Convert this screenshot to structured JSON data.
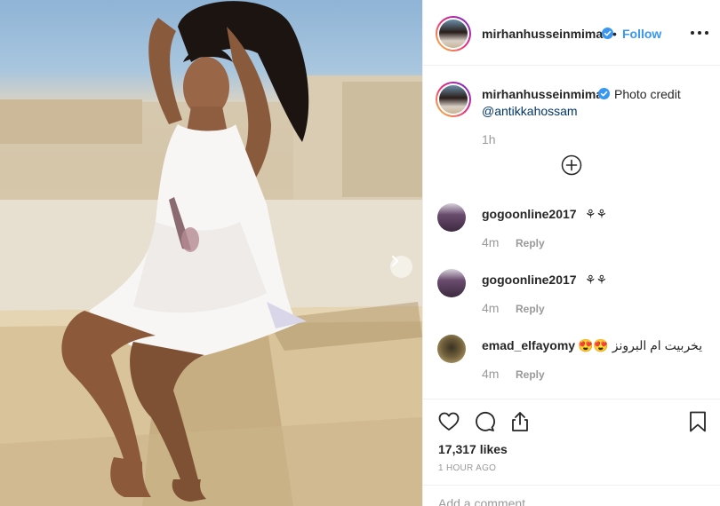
{
  "post": {
    "author": "mirhanhusseinmima",
    "follow_label": "Follow",
    "separator": "•",
    "more_icon": "more-horizontal-icon"
  },
  "caption": {
    "author": "mirhanhusseinmima",
    "text": "Photo credit",
    "mention": "@antikkahossam",
    "time": "1h"
  },
  "comments": [
    {
      "user": "gogoonline2017",
      "text": "⚘⚘",
      "time": "4m",
      "reply_label": "Reply"
    },
    {
      "user": "gogoonline2017",
      "text": "⚘⚘",
      "time": "4m",
      "reply_label": "Reply"
    },
    {
      "user": "emad_elfayomy",
      "text": "يخربيت ام البرونز 😍😍",
      "time": "4m",
      "reply_label": "Reply"
    }
  ],
  "stats": {
    "likes": "17,317 likes",
    "posted": "1 HOUR AGO"
  },
  "add_comment": {
    "placeholder": "Add a comment…"
  },
  "colors": {
    "link_blue": "#3897f0",
    "mention_blue": "#003569",
    "muted": "#999999",
    "verified_blue": "#3897f0"
  }
}
